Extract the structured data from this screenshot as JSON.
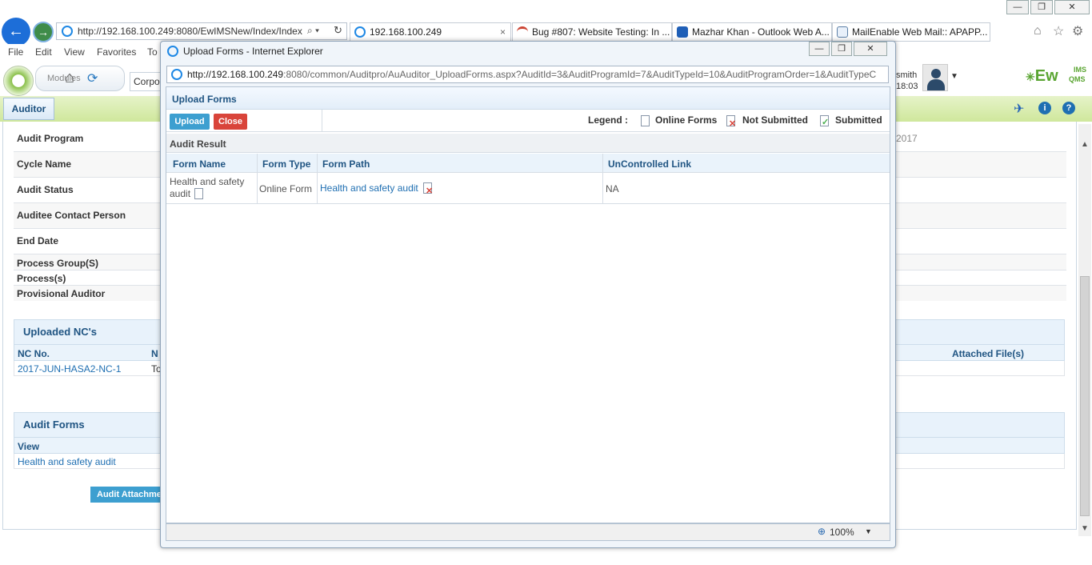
{
  "browser": {
    "address_url": "http://192.168.100.249:8080/EwIMSNew/Index/Index",
    "tabs": [
      {
        "label": "192.168.100.249"
      },
      {
        "label": "Bug #807: Website Testing: In ..."
      },
      {
        "label": "Mazhar Khan - Outlook Web A..."
      },
      {
        "label": "MailEnable Web Mail:: APAPP..."
      }
    ],
    "menu": [
      "File",
      "Edit",
      "View",
      "Favorites",
      "To"
    ]
  },
  "app": {
    "modules_label": "Modules",
    "corp_label": "Corpo",
    "user_label": "smith",
    "time_label": "18:03",
    "logo_text": "Ew",
    "logo_sup": "IMS",
    "logo_sub": "QMS",
    "role_tab": "Auditor",
    "year_fragment": "2017"
  },
  "background": {
    "fields": [
      {
        "label": "Audit Program"
      },
      {
        "label": "Cycle Name"
      },
      {
        "label": "Audit Status"
      },
      {
        "label": "Auditee Contact Person"
      },
      {
        "label": "End Date"
      },
      {
        "label": "Process Group(S)"
      },
      {
        "label": "Process(s)"
      },
      {
        "label": "Provisional Auditor"
      }
    ],
    "uploaded_nc": {
      "title": "Uploaded NC's",
      "col_nc": "NC No.",
      "col_n": "N",
      "col_attached": "Attached File(s)",
      "row_nc": "2017-JUN-HASA2-NC-1",
      "row_n": "To"
    },
    "audit_forms": {
      "title": "Audit Forms",
      "col_view": "View",
      "row_link": "Health and safety audit"
    },
    "attach_button": "Audit Attachme"
  },
  "popup": {
    "window_title": "Upload Forms - Internet Explorer",
    "url_host": "http://192.168.100.249",
    "url_rest": ":8080/common/Auditpro/AuAuditor_UploadForms.aspx?AuditId=3&AuditProgramId=7&AuditTypeId=10&AuditProgramOrder=1&AuditTypeC",
    "heading": "Upload Forms",
    "upload_button": "Upload",
    "close_button": "Close",
    "legend_label": "Legend :",
    "legend_online": "Online Forms",
    "legend_not_submitted": "Not Submitted",
    "legend_submitted": "Submitted",
    "result_title": "Audit Result",
    "columns": {
      "form_name": "Form Name",
      "form_type": "Form Type",
      "form_path": "Form Path",
      "uncontrolled": "UnControlled Link"
    },
    "row": {
      "form_name_line1": "Health and safety",
      "form_name_line2": "audit",
      "form_type": "Online Form",
      "form_path": "Health and safety audit",
      "uncontrolled": "NA"
    },
    "zoom": "100%"
  },
  "colors": {
    "ie_blue": "#1e88e5",
    "upload_btn": "#3d9fd0",
    "close_btn": "#d9443a",
    "header_blue": "#1f5482"
  }
}
